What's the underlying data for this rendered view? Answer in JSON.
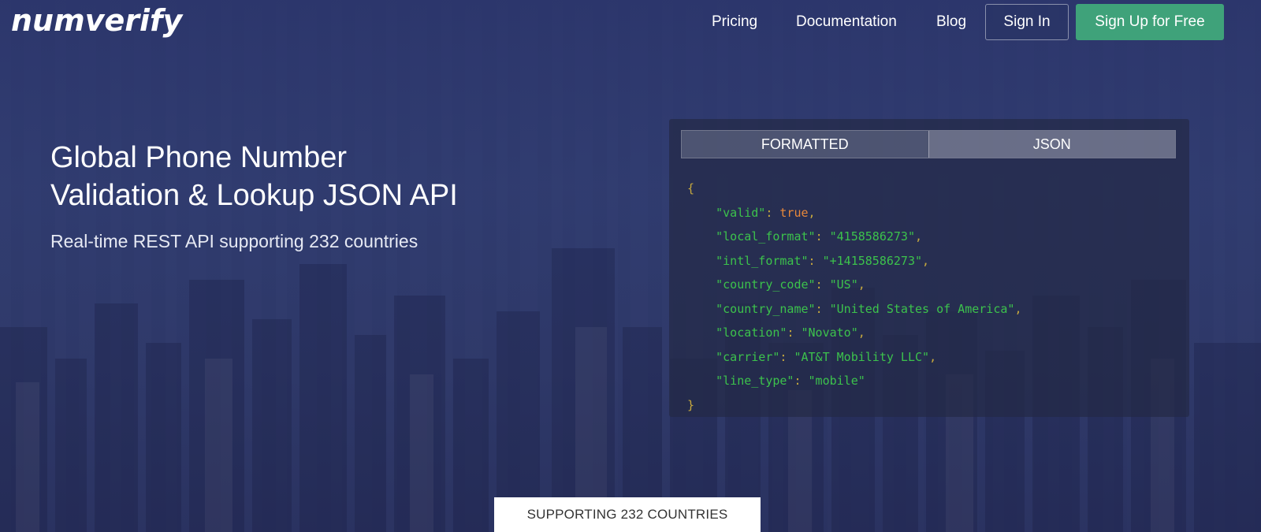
{
  "brand": {
    "logo_text": "numverify"
  },
  "nav": {
    "links": [
      "Pricing",
      "Documentation",
      "Blog"
    ],
    "sign_in": "Sign In",
    "sign_up": "Sign Up for Free"
  },
  "hero": {
    "headline_line1": "Global Phone Number",
    "headline_line2": "Validation & Lookup JSON API",
    "subline": "Real-time REST API supporting 232 countries"
  },
  "panel": {
    "tabs": [
      "FORMATTED",
      "JSON"
    ],
    "code": {
      "open": "{",
      "close": "}",
      "fields": [
        {
          "key": "\"valid\"",
          "value": "true",
          "type": "bool"
        },
        {
          "key": "\"local_format\"",
          "value": "\"4158586273\"",
          "type": "str"
        },
        {
          "key": "\"intl_format\"",
          "value": "\"+14158586273\"",
          "type": "str"
        },
        {
          "key": "\"country_code\"",
          "value": "\"US\"",
          "type": "str"
        },
        {
          "key": "\"country_name\"",
          "value": "\"United States of America\"",
          "type": "str"
        },
        {
          "key": "\"location\"",
          "value": "\"Novato\"",
          "type": "str"
        },
        {
          "key": "\"carrier\"",
          "value": "\"AT&T Mobility LLC\"",
          "type": "str"
        },
        {
          "key": "\"line_type\"",
          "value": "\"mobile\"",
          "type": "str"
        }
      ]
    }
  },
  "badge": {
    "text": "SUPPORTING 232 COUNTRIES"
  },
  "colors": {
    "background": "#2f3a6e",
    "signup_button": "#3fa27a",
    "json_key": "#3cc24c",
    "json_bool": "#e8883a",
    "json_brace": "#c7a93e"
  }
}
